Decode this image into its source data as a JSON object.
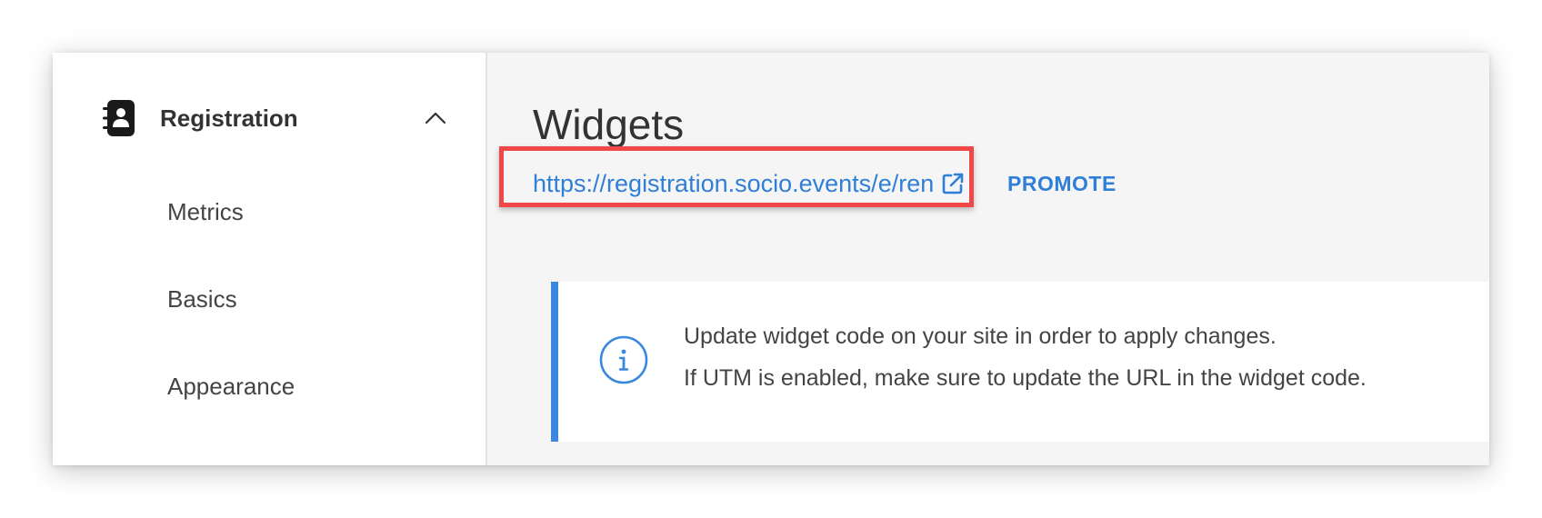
{
  "sidebar": {
    "section": {
      "title": "Registration",
      "icon": "registration-book-icon",
      "toggle_icon": "chevron-up-icon"
    },
    "items": [
      {
        "label": "Metrics"
      },
      {
        "label": "Basics"
      },
      {
        "label": "Appearance"
      }
    ]
  },
  "main": {
    "title": "Widgets",
    "link": {
      "text": "https://registration.socio.events/e/ren",
      "icon": "external-link-icon"
    },
    "promote_label": "PROMOTE",
    "info": {
      "icon": "info-icon",
      "line1": "Update widget code on your site in order to apply changes.",
      "line2": "If UTM is enabled, make sure to update the URL in the widget code."
    }
  },
  "colors": {
    "accent": "#2f7fd8",
    "info_border": "#3a87de",
    "highlight": "#f04848",
    "sidebar_bg": "#ffffff",
    "main_bg": "#f5f5f5"
  }
}
